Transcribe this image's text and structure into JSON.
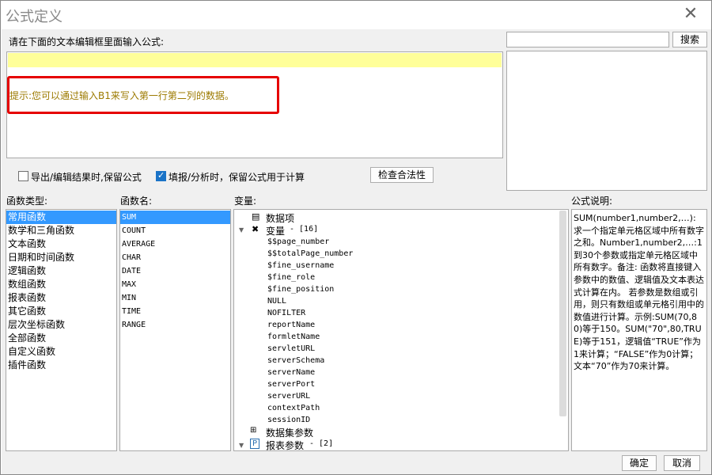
{
  "window": {
    "title": "公式定义",
    "close_glyph": "✕"
  },
  "editor": {
    "prompt": "请在下面的文本编辑框里面输入公式:",
    "hint": "提示:您可以通过输入B1来写入第一行第二列的数据。"
  },
  "search": {
    "value": "",
    "button": "搜索"
  },
  "options": {
    "export_keep": {
      "label": "导出/编辑结果时,保留公式",
      "checked": false
    },
    "fill_keep": {
      "label": "填报/分析时，保留公式用于计算",
      "checked": true
    },
    "check_button": "检查合法性"
  },
  "labels": {
    "func_type": "函数类型:",
    "func_name": "函数名:",
    "variables": "变量:",
    "description": "公式说明:"
  },
  "func_types": [
    "常用函数",
    "数学和三角函数",
    "文本函数",
    "日期和时间函数",
    "逻辑函数",
    "数组函数",
    "报表函数",
    "其它函数",
    "层次坐标函数",
    "全部函数",
    "自定义函数",
    "插件函数"
  ],
  "func_names": [
    "SUM",
    "COUNT",
    "AVERAGE",
    "CHAR",
    "DATE",
    "MAX",
    "MIN",
    "TIME",
    "RANGE"
  ],
  "variables": {
    "data_item": "数据项",
    "var_group": "变量",
    "var_count": "- [16]",
    "vars": [
      "$$page_number",
      "$$totalPage_number",
      "$fine_username",
      "$fine_role",
      "$fine_position",
      "NULL",
      "NOFILTER",
      "reportName",
      "formletName",
      "servletURL",
      "serverSchema",
      "serverName",
      "serverPort",
      "serverURL",
      "contextPath",
      "sessionID"
    ],
    "dataset_params": "数据集参数",
    "report_params": "报表参数",
    "report_params_count": "- [2]"
  },
  "description": "SUM(number1,number2,…): 求一个指定单元格区域中所有数字之和。Number1,number2,…:1到30个参数或指定单元格区域中所有数字。备注:    函数将直接键入参数中的数值、逻辑值及文本表达式计算在内。    若参数是数组或引用，则只有数组或单元格引用中的数值进行计算。示例:SUM(70,80)等于150。SUM(\"70\",80,TRUE)等于151，逻辑值“TRUE”作为1来计算；“FALSE”作为0计算；文本“70”作为70来计算。",
  "footer": {
    "ok": "确定",
    "cancel": "取消"
  },
  "colors": {
    "selection": "#3399ff",
    "hint_text": "#9c7a00",
    "highlight_line": "#ffff99",
    "annotation": "#e60000"
  }
}
